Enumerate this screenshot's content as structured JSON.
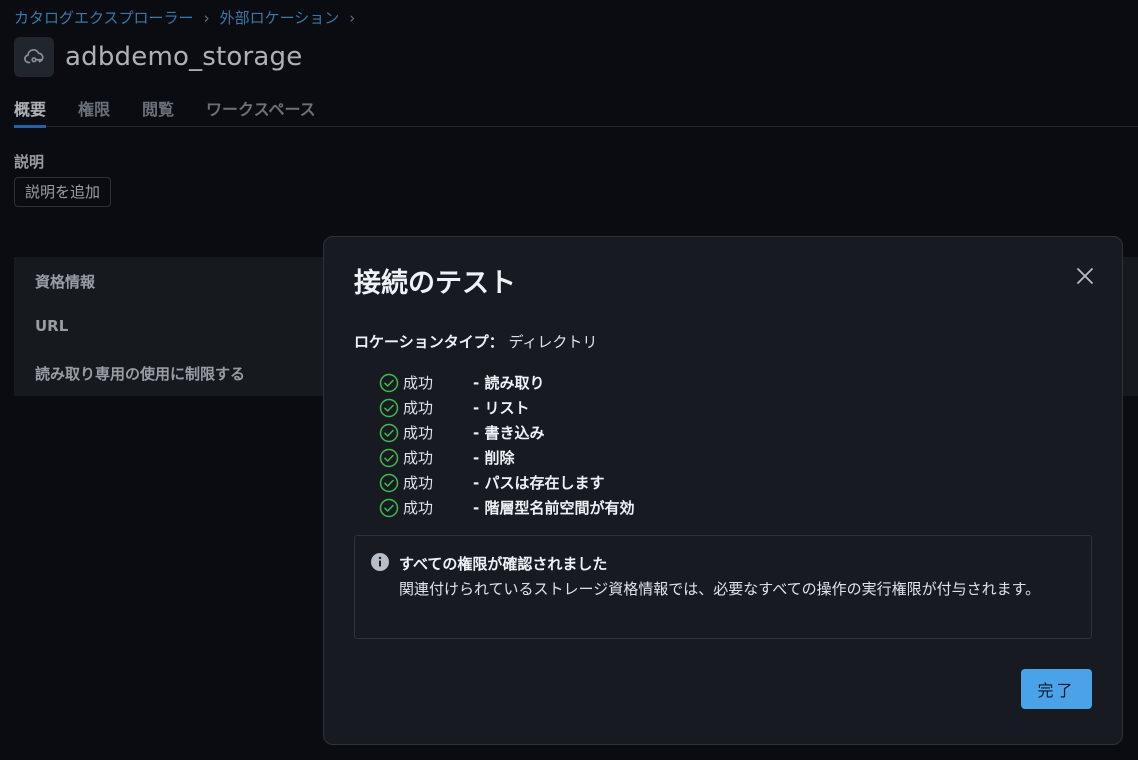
{
  "breadcrumb": {
    "items": [
      "カタログエクスプローラー",
      "外部ロケーション"
    ],
    "separator": "›"
  },
  "page": {
    "title": "adbdemo_storage",
    "title_icon": "cloud-key-icon"
  },
  "tabs": [
    {
      "label": "概要",
      "active": true
    },
    {
      "label": "権限",
      "active": false
    },
    {
      "label": "閲覧",
      "active": false
    },
    {
      "label": "ワークスペース",
      "active": false
    }
  ],
  "description": {
    "label": "説明",
    "add_button": "説明を追加"
  },
  "details": {
    "rows": [
      "資格情報",
      "URL",
      "読み取り専用の使用に制限する"
    ]
  },
  "modal": {
    "title": "接続のテスト",
    "location_type_label": "ロケーションタイプ：",
    "location_type_value": "ディレクトリ",
    "checks": [
      {
        "status": "成功",
        "operation": "- 読み取り"
      },
      {
        "status": "成功",
        "operation": "- リスト"
      },
      {
        "status": "成功",
        "operation": "- 書き込み"
      },
      {
        "status": "成功",
        "operation": "- 削除"
      },
      {
        "status": "成功",
        "operation": "- パスは存在します"
      },
      {
        "status": "成功",
        "operation": "- 階層型名前空間が有効"
      }
    ],
    "info_title": "すべての権限が確認されました",
    "info_text": "関連付けられているストレージ資格情報では、必要なすべての操作の実行権限が付与されます。",
    "done_button": "完了"
  },
  "colors": {
    "accent": "#4aa3e8",
    "link": "#4a9ee0",
    "success": "#3fb950",
    "background": "#0b0e13",
    "modal_background": "#171b21"
  }
}
